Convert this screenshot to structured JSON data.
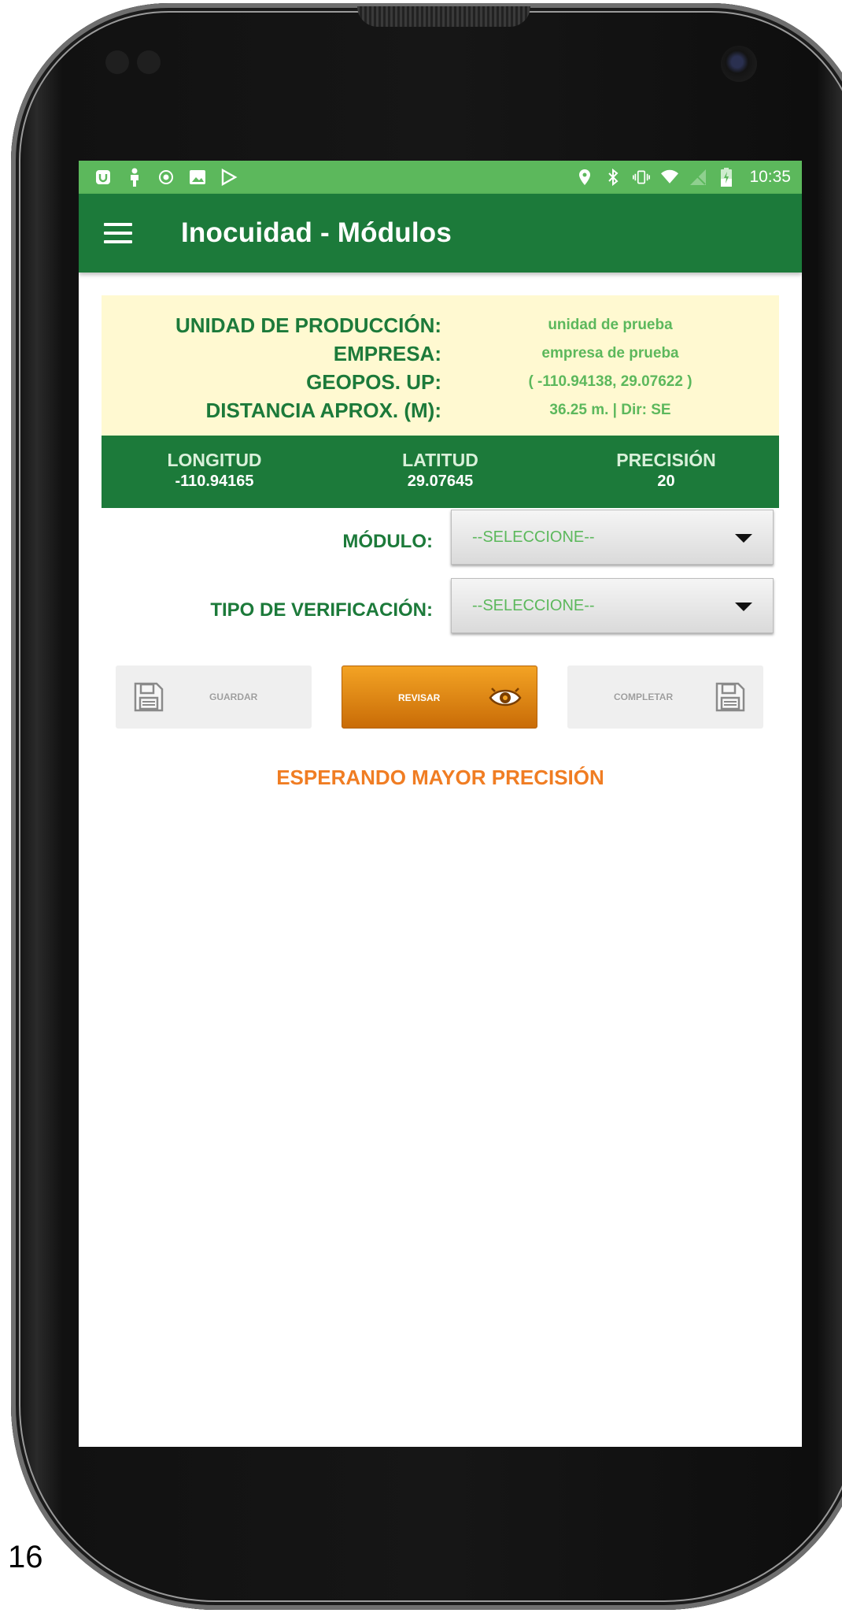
{
  "status_bar": {
    "time": "10:35"
  },
  "app_bar": {
    "title": "Inocuidad - Módulos"
  },
  "info": {
    "unidad_label": "UNIDAD DE PRODUCCIÓN:",
    "unidad_value": "unidad de prueba",
    "empresa_label": "EMPRESA:",
    "empresa_value": "empresa de prueba",
    "geopos_label": "GEOPOS. UP:",
    "geopos_value": "( -110.94138, 29.07622 )",
    "distancia_label": "DISTANCIA APROX. (M):",
    "distancia_value": "36.25 m. | Dir: SE"
  },
  "coords": {
    "longitud_label": "LONGITUD",
    "longitud_value": "-110.94165",
    "latitud_label": "LATITUD",
    "latitud_value": "29.07645",
    "precision_label": "PRECISIÓN",
    "precision_value": "20"
  },
  "form": {
    "modulo_label": "MÓDULO:",
    "modulo_value": "--SELECCIONE--",
    "tipo_label": "TIPO DE VERIFICACIÓN:",
    "tipo_value": "--SELECCIONE--"
  },
  "buttons": {
    "guardar": "GUARDAR",
    "revisar": "REVISAR",
    "completar": "COMPLETAR"
  },
  "status_message": "ESPERANDO MAYOR PRECISIÓN",
  "page_number": "16",
  "colors": {
    "status_bar": "#5cb85c",
    "app_bar": "#1c7a3a",
    "info_bg": "#fff9d1",
    "accent_orange": "#f07d23"
  }
}
